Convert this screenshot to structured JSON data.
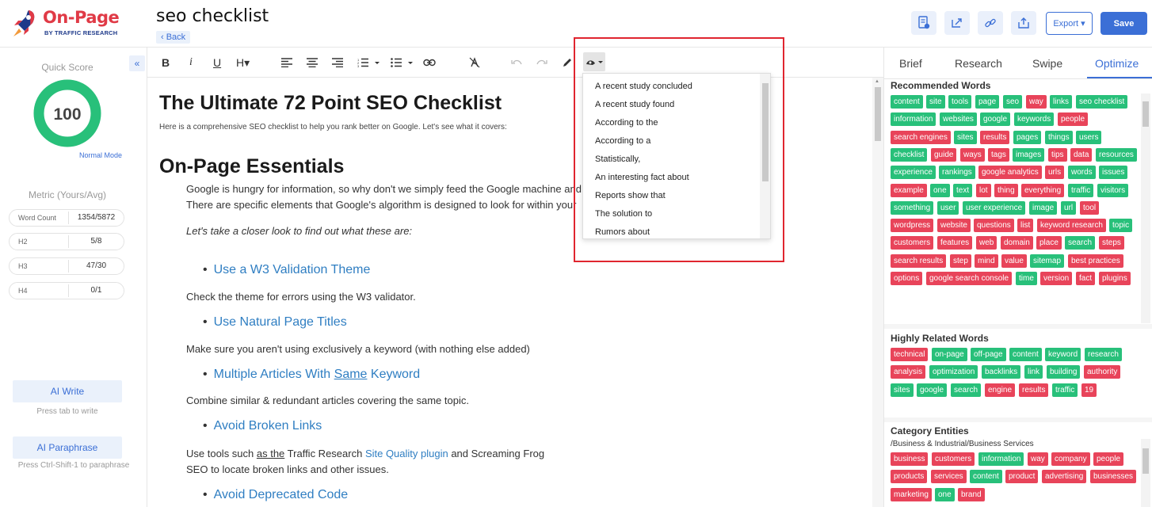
{
  "header": {
    "logo_brand": "On-Page",
    "logo_sub": "BY TRAFFIC RESEARCH",
    "doc_title": "seo checklist",
    "back_label": "‹ Back",
    "export_label": "Export ▾",
    "save_label": "Save",
    "icons": [
      "document-settings-icon",
      "share-icon",
      "link-icon",
      "upload-icon"
    ]
  },
  "left": {
    "quick_score_label": "Quick Score",
    "score": "100",
    "score_fraction": 1.0,
    "mode_label": "Normal Mode",
    "metric_label": "Metric (Yours/Avg)",
    "metrics": [
      {
        "key": "Word Count",
        "value": "1354/5872"
      },
      {
        "key": "H2",
        "value": "5/8"
      },
      {
        "key": "H3",
        "value": "47/30"
      },
      {
        "key": "H4",
        "value": "0/1"
      }
    ],
    "ai_write_label": "AI Write",
    "ai_write_hint": "Press tab to write",
    "ai_paraphrase_label": "AI Paraphrase",
    "ai_paraphrase_hint": "Press Ctrl-Shift-1 to paraphrase"
  },
  "toolbar": {
    "bold": "B",
    "italic": "i",
    "underline": "U",
    "heading": "H▾"
  },
  "editor": {
    "title": "The Ultimate 72 Point SEO Checklist",
    "intro": "Here is a comprehensive SEO checklist to help you rank better on Google. Let's see what it covers:",
    "h_onpage": "On-Page Essentials",
    "p1": "Google is hungry for information, so why don't we simply feed the Google machine and",
    "p2": "There are specific elements that Google's algorithm is designed to look for within your",
    "p3": "Let's take a closer look to find out what these are:",
    "li1": "Use a W3 Validation Theme",
    "p4": "Check the theme for errors using the W3 validator.",
    "li2": "Use Natural Page Titles",
    "p5": "Make sure you aren't using exclusively a keyword (with nothing else added)",
    "li3_a": "Multiple Articles With ",
    "li3_b": "Same",
    "li3_c": " Keyword",
    "p6": "Combine similar & redundant articles covering the same topic.",
    "li4": "Avoid Broken Links",
    "p7_a": "Use tools such ",
    "p7_b": "as the",
    "p7_c": " Traffic Research ",
    "p7_link": "Site Quality plugin",
    "p7_d": " and Screaming Frog",
    "p8": "SEO to locate broken links and other issues.",
    "li5": "Avoid Deprecated Code"
  },
  "dropdown": {
    "options": [
      "A recent study concluded",
      "A recent study found",
      "According to the",
      "According to a",
      "Statistically,",
      "An interesting fact about",
      "Reports show that",
      "The solution to",
      "Rumors about"
    ]
  },
  "right": {
    "tabs": [
      "Brief",
      "Research",
      "Swipe",
      "Optimize"
    ],
    "recommended_title": "Recommended Words",
    "highly_related_title": "Highly Related Words",
    "category_title": "Category Entities",
    "category_path": "/Business & Industrial/Business Services",
    "recommended": [
      [
        "content",
        "g"
      ],
      [
        "site",
        "g"
      ],
      [
        "tools",
        "g"
      ],
      [
        "page",
        "g"
      ],
      [
        "seo",
        "g"
      ],
      [
        "way",
        "r"
      ],
      [
        "links",
        "g"
      ],
      [
        "seo checklist",
        "g"
      ],
      [
        "information",
        "g"
      ],
      [
        "websites",
        "g"
      ],
      [
        "google",
        "g"
      ],
      [
        "keywords",
        "g"
      ],
      [
        "people",
        "r"
      ],
      [
        "search engines",
        "r"
      ],
      [
        "sites",
        "g"
      ],
      [
        "results",
        "r"
      ],
      [
        "pages",
        "g"
      ],
      [
        "things",
        "g"
      ],
      [
        "users",
        "g"
      ],
      [
        "checklist",
        "g"
      ],
      [
        "guide",
        "r"
      ],
      [
        "ways",
        "r"
      ],
      [
        "tags",
        "r"
      ],
      [
        "images",
        "g"
      ],
      [
        "tips",
        "r"
      ],
      [
        "data",
        "r"
      ],
      [
        "resources",
        "g"
      ],
      [
        "experience",
        "g"
      ],
      [
        "rankings",
        "g"
      ],
      [
        "google analytics",
        "r"
      ],
      [
        "urls",
        "r"
      ],
      [
        "words",
        "g"
      ],
      [
        "issues",
        "g"
      ],
      [
        "example",
        "r"
      ],
      [
        "one",
        "g"
      ],
      [
        "text",
        "g"
      ],
      [
        "lot",
        "r"
      ],
      [
        "thing",
        "r"
      ],
      [
        "everything",
        "r"
      ],
      [
        "traffic",
        "g"
      ],
      [
        "visitors",
        "g"
      ],
      [
        "something",
        "g"
      ],
      [
        "user",
        "g"
      ],
      [
        "user experience",
        "g"
      ],
      [
        "image",
        "g"
      ],
      [
        "url",
        "g"
      ],
      [
        "tool",
        "r"
      ],
      [
        "wordpress",
        "r"
      ],
      [
        "website",
        "r"
      ],
      [
        "questions",
        "r"
      ],
      [
        "list",
        "r"
      ],
      [
        "keyword research",
        "r"
      ],
      [
        "topic",
        "g"
      ],
      [
        "customers",
        "r"
      ],
      [
        "features",
        "r"
      ],
      [
        "web",
        "r"
      ],
      [
        "domain",
        "r"
      ],
      [
        "place",
        "r"
      ],
      [
        "search",
        "g"
      ],
      [
        "steps",
        "r"
      ],
      [
        "search results",
        "r"
      ],
      [
        "step",
        "r"
      ],
      [
        "mind",
        "r"
      ],
      [
        "value",
        "r"
      ],
      [
        "sitemap",
        "g"
      ],
      [
        "best practices",
        "r"
      ],
      [
        "options",
        "r"
      ],
      [
        "google search console",
        "r"
      ],
      [
        "time",
        "g"
      ],
      [
        "version",
        "r"
      ],
      [
        "fact",
        "r"
      ],
      [
        "plugins",
        "r"
      ]
    ],
    "highly_related": [
      [
        "technical",
        "r"
      ],
      [
        "on-page",
        "g"
      ],
      [
        "off-page",
        "g"
      ],
      [
        "content",
        "g"
      ],
      [
        "keyword",
        "g"
      ],
      [
        "research",
        "g"
      ],
      [
        "analysis",
        "r"
      ],
      [
        "optimization",
        "g"
      ],
      [
        "backlinks",
        "g"
      ],
      [
        "link",
        "g"
      ],
      [
        "building",
        "g"
      ],
      [
        "authority",
        "r"
      ],
      [
        "sites",
        "g"
      ],
      [
        "google",
        "g"
      ],
      [
        "search",
        "g"
      ],
      [
        "engine",
        "r"
      ],
      [
        "results",
        "r"
      ],
      [
        "traffic",
        "g"
      ],
      [
        "19",
        "r"
      ]
    ],
    "category": [
      [
        "business",
        "r"
      ],
      [
        "customers",
        "r"
      ],
      [
        "information",
        "g"
      ],
      [
        "way",
        "r"
      ],
      [
        "company",
        "r"
      ],
      [
        "people",
        "r"
      ],
      [
        "products",
        "r"
      ],
      [
        "services",
        "r"
      ],
      [
        "content",
        "g"
      ],
      [
        "product",
        "r"
      ],
      [
        "advertising",
        "r"
      ],
      [
        "businesses",
        "r"
      ],
      [
        "marketing",
        "r"
      ],
      [
        "one",
        "g"
      ],
      [
        "brand",
        "r"
      ]
    ]
  },
  "colors": {
    "accent": "#3b6fd6",
    "brand_red": "#e03a46",
    "chip_green": "#28c07a",
    "chip_red": "#e8445a",
    "score_green": "#28c07a",
    "highlight_box": "#e0252f"
  }
}
